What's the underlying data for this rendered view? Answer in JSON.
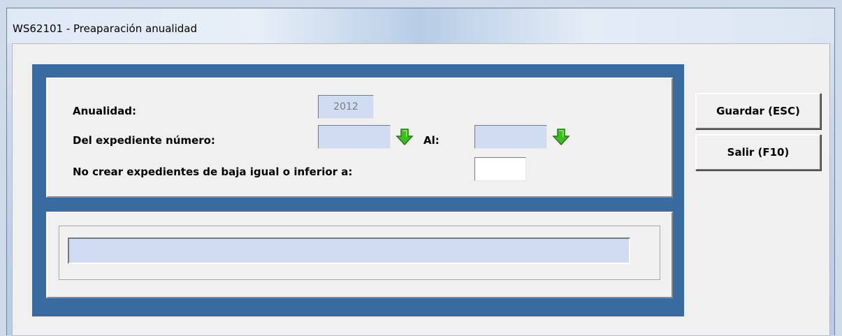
{
  "window": {
    "title": "WS62101 - Preaparación anualidad"
  },
  "form": {
    "anualidad_label": "Anualidad:",
    "anualidad_value": "2012",
    "del_expediente_label": "Del expediente número:",
    "del_expediente_value": "",
    "al_label": "Al:",
    "al_value": "",
    "no_crear_label": "No crear expedientes de baja igual o inferior a:",
    "no_crear_value": ""
  },
  "progress": {
    "value": 0
  },
  "buttons": {
    "guardar": "Guardar (ESC)",
    "salir": "Salir (F10)"
  },
  "icons": {
    "arrow_down": "green-arrow-down-icon",
    "arrow_color": "#3cbf1a"
  }
}
